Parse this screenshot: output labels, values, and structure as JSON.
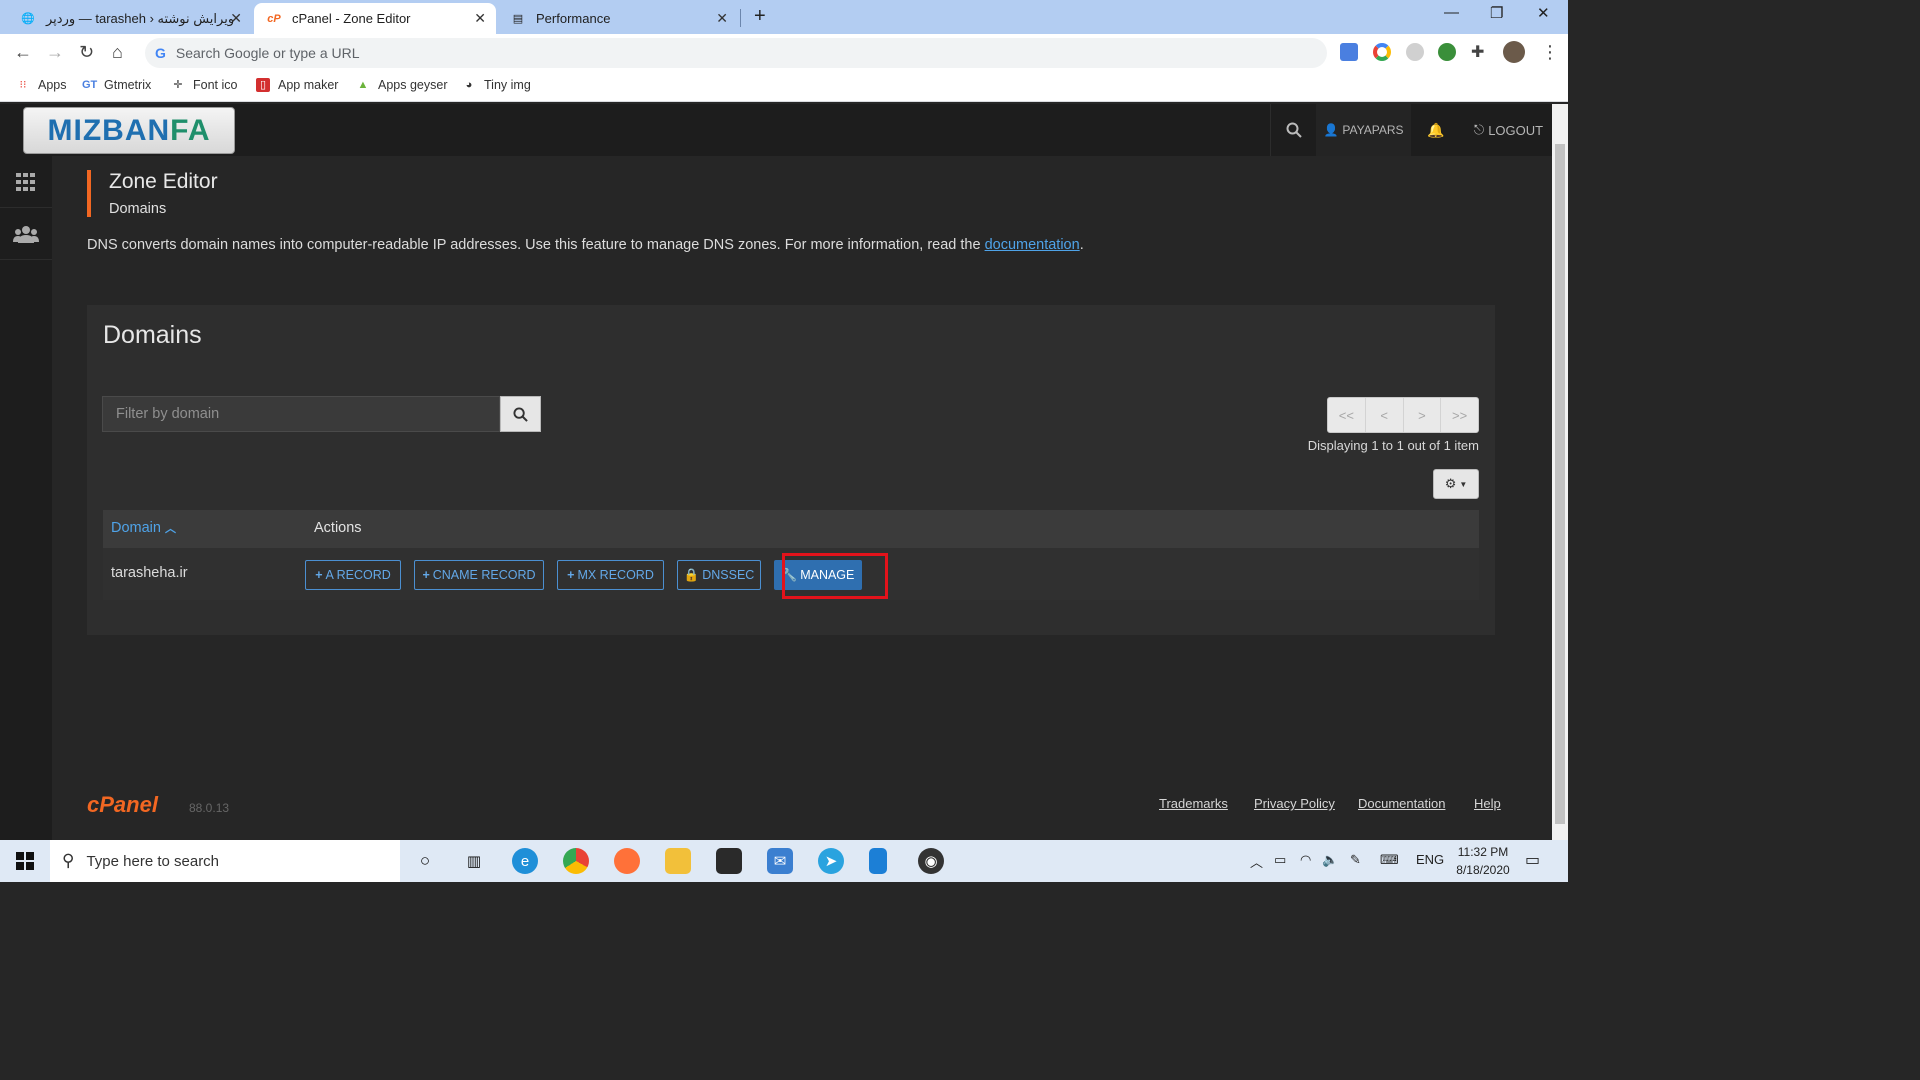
{
  "browser": {
    "tabs": [
      {
        "title": "ویرایش نوشته ‹ tarasheh — وردپر",
        "active": false
      },
      {
        "title": "cPanel - Zone Editor",
        "active": true
      },
      {
        "title": "Performance",
        "active": false
      }
    ],
    "new_tab": "+",
    "omnibox_placeholder": "Search Google or type a URL",
    "bookmarks": [
      "Apps",
      "Gtmetrix",
      "Font ico",
      "App maker",
      "Apps geyser",
      "Tiny img"
    ]
  },
  "cpanel": {
    "logo": {
      "part1": "MIZBAN",
      "part2": "FA"
    },
    "user": "PAYAPARS",
    "logout": "LOGOUT",
    "page_title": "Zone Editor",
    "page_subtitle": "Domains",
    "intro_text": "DNS converts domain names into computer-readable IP addresses. Use this feature to manage DNS zones. For more information, read the ",
    "intro_link": "documentation",
    "intro_end": ".",
    "panel_title": "Domains",
    "filter_placeholder": "Filter by domain",
    "pager": [
      "<<",
      "<",
      ">",
      ">>"
    ],
    "displaying": "Displaying 1 to 1 out of 1 item",
    "table": {
      "headers": {
        "domain": "Domain",
        "actions": "Actions"
      },
      "rows": [
        {
          "domain": "tarasheha.ir",
          "actions": [
            "A RECORD",
            "CNAME RECORD",
            "MX RECORD",
            "DNSSEC",
            "MANAGE"
          ]
        }
      ]
    },
    "footer": {
      "logo": "cPanel",
      "version": "88.0.13",
      "links": [
        "Trademarks",
        "Privacy Policy",
        "Documentation",
        "Help"
      ]
    }
  },
  "taskbar": {
    "search_placeholder": "Type here to search",
    "language": "ENG",
    "time": "11:32 PM",
    "date": "8/18/2020"
  },
  "colors": {
    "accent": "#f26722",
    "link": "#4fa3e8",
    "manage_button": "#2f6fb0",
    "highlight": "#e3131b"
  }
}
